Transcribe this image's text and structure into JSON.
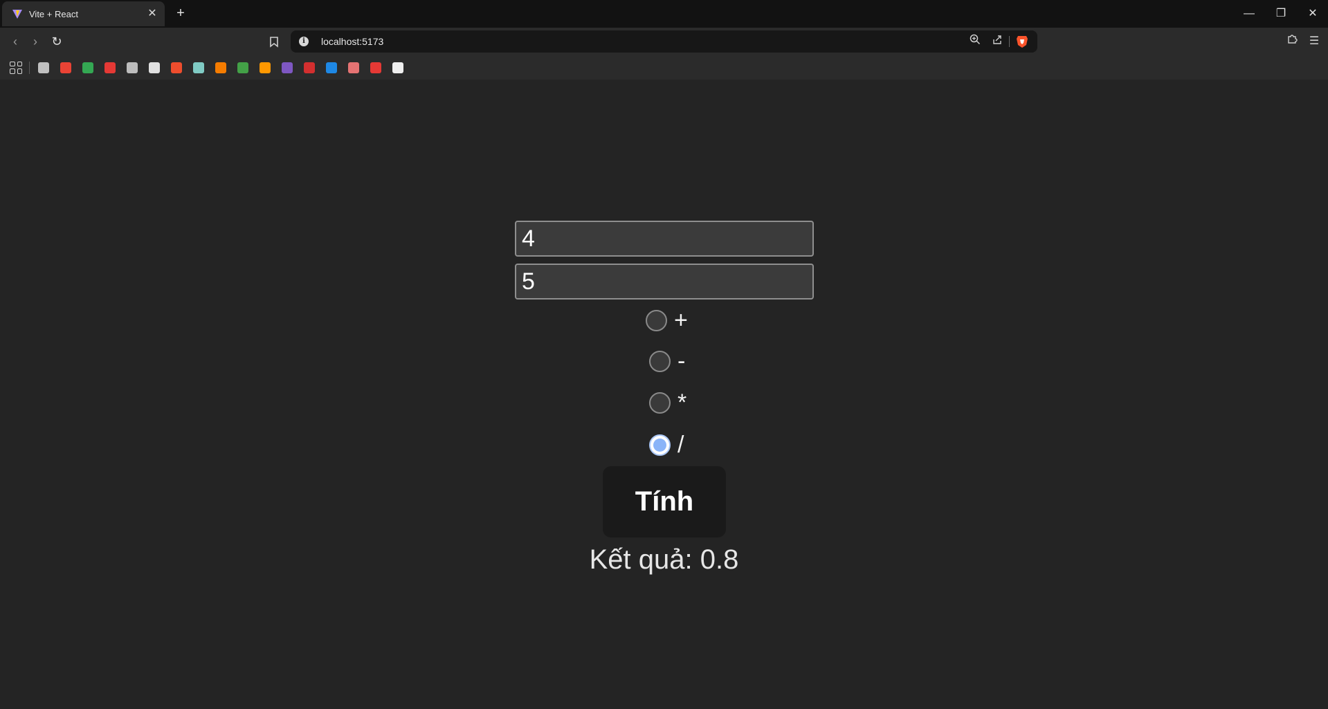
{
  "browser": {
    "tab": {
      "title": "Vite + React"
    },
    "address_bar": {
      "url": "localhost:5173"
    },
    "bookmark_icons": [
      {
        "name": "apple-icon",
        "color": "#c0c0c0"
      },
      {
        "name": "gmail-icon",
        "color": "#ea4335"
      },
      {
        "name": "google-drive-icon",
        "color": "#34a853"
      },
      {
        "name": "bookmark-red-icon",
        "color": "#e53935"
      },
      {
        "name": "bookmark-file-icon",
        "color": "#bdbdbd"
      },
      {
        "name": "bookmark-circle-icon",
        "color": "#e0e0e0"
      },
      {
        "name": "shopee-icon",
        "color": "#ee4d2d"
      },
      {
        "name": "bookmark-map-icon",
        "color": "#80cbc4"
      },
      {
        "name": "bookmark-orange-play-icon",
        "color": "#f57c00"
      },
      {
        "name": "bookmark-green-icon",
        "color": "#43a047"
      },
      {
        "name": "bookmark-hand-icon",
        "color": "#ff9800"
      },
      {
        "name": "bookmark-purple-play-icon",
        "color": "#7e57c2"
      },
      {
        "name": "bookmark-red-bird-icon",
        "color": "#d32f2f"
      },
      {
        "name": "zing-icon",
        "color": "#1e88e5"
      },
      {
        "name": "bookmark-shield-icon",
        "color": "#e57373"
      },
      {
        "name": "bookmark-tnk-icon",
        "color": "#e53935"
      },
      {
        "name": "bookmark-white-icon",
        "color": "#eeeeee"
      }
    ]
  },
  "calculator": {
    "input_a": {
      "value": "4"
    },
    "input_b": {
      "value": "5"
    },
    "operations": [
      {
        "label": "+",
        "checked": false
      },
      {
        "label": "-",
        "checked": false
      },
      {
        "label": "*",
        "checked": false
      },
      {
        "label": "/",
        "checked": true
      }
    ],
    "calc_button_label": "Tính",
    "result_text": "Kết quả: 0.8"
  }
}
